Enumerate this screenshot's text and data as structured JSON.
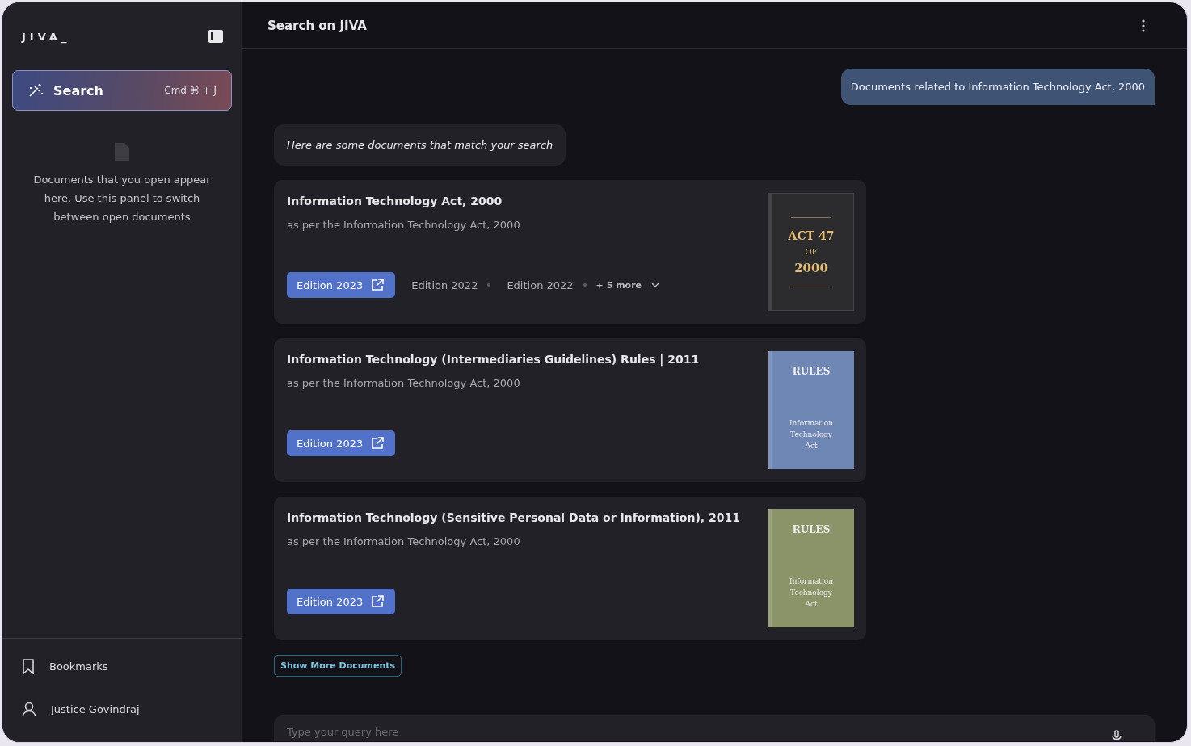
{
  "sidebar": {
    "logo": "JIVA_",
    "search": {
      "label": "Search",
      "shortcut": "Cmd ⌘ + J"
    },
    "empty_text": "Documents that you open appear here. Use this panel to switch between open documents",
    "footer": [
      {
        "kind": "bookmark",
        "label": "Bookmarks"
      },
      {
        "kind": "user",
        "label": "Justice Govindraj"
      }
    ]
  },
  "header": {
    "title": "Search on JIVA"
  },
  "user_message": "Documents related to Information Technology Act, 2000",
  "reply": "Here are some documents that match your search",
  "documents": [
    {
      "title": "Information Technology Act, 2000",
      "subtitle": "as per the Information Technology Act, 2000",
      "primary_edition": "Edition 2023",
      "other_editions": [
        "Edition 2022",
        "Edition 2022"
      ],
      "more": "+ 5 more",
      "cover": {
        "kind": "act",
        "color": "#2c2b2e",
        "lines": [
          "ACT 47",
          "OF",
          "2000"
        ]
      }
    },
    {
      "title": "Information Technology (Intermediaries Guidelines) Rules | 2011",
      "subtitle": "as per the Information Technology Act, 2000",
      "primary_edition": "Edition 2023",
      "cover": {
        "kind": "rules",
        "color": "#6f87b4",
        "lines": [
          "RULES",
          "Information Technology Act"
        ]
      }
    },
    {
      "title": "Information Technology (Sensitive Personal Data or Information), 2011",
      "subtitle": "as per the Information Technology Act, 2000",
      "primary_edition": "Edition 2023",
      "cover": {
        "kind": "rules",
        "color": "#8a9468",
        "lines": [
          "RULES",
          "Information Technology Act"
        ]
      }
    }
  ],
  "show_more": "Show More Documents",
  "query": {
    "placeholder": "Type your query here"
  }
}
